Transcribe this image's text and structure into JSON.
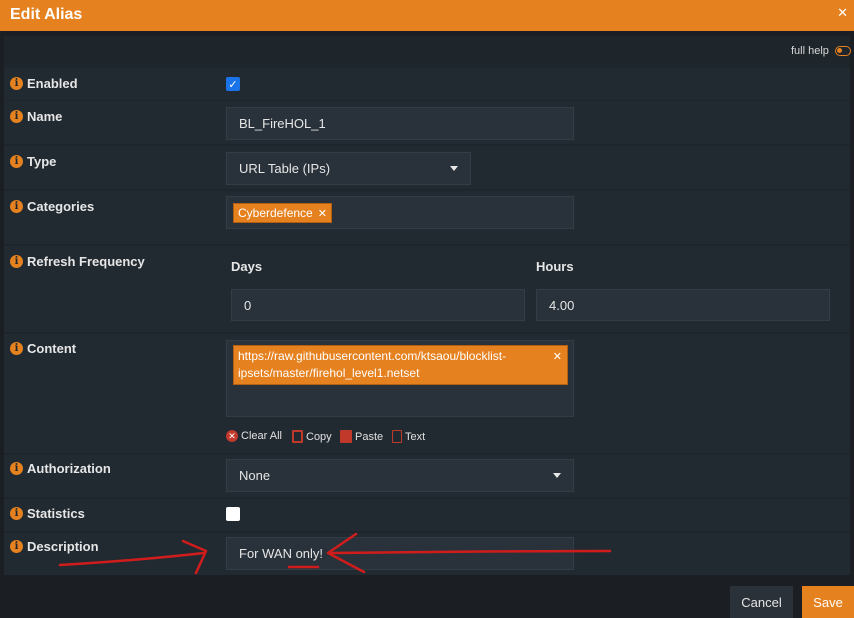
{
  "dialog": {
    "title": "Edit Alias"
  },
  "help": {
    "label": "full help"
  },
  "fields": {
    "enabled": {
      "label": "Enabled",
      "checked": true
    },
    "name": {
      "label": "Name",
      "value": "BL_FireHOL_1"
    },
    "type": {
      "label": "Type",
      "value": "URL Table (IPs)"
    },
    "categories": {
      "label": "Categories",
      "tags": [
        "Cyberdefence"
      ]
    },
    "refresh": {
      "label": "Refresh Frequency",
      "days_label": "Days",
      "days_value": "0",
      "hours_label": "Hours",
      "hours_value": "4.00"
    },
    "content": {
      "label": "Content",
      "tag_line1": "https://raw.githubusercontent.com/ktsaou/blocklist-",
      "tag_line2": "ipsets/master/firehol_level1.netset",
      "actions": {
        "clear_all": "Clear All",
        "copy": "Copy",
        "paste": "Paste",
        "text": "Text"
      }
    },
    "authorization": {
      "label": "Authorization",
      "value": "None"
    },
    "statistics": {
      "label": "Statistics",
      "checked": false
    },
    "description": {
      "label": "Description",
      "value": "For WAN only!"
    }
  },
  "footer": {
    "cancel_label": "Cancel",
    "save_label": "Save"
  },
  "colors": {
    "accent": "#e5811f",
    "panel": "#1e252b",
    "field": "#29323a",
    "annotation": "#d11c1c"
  }
}
